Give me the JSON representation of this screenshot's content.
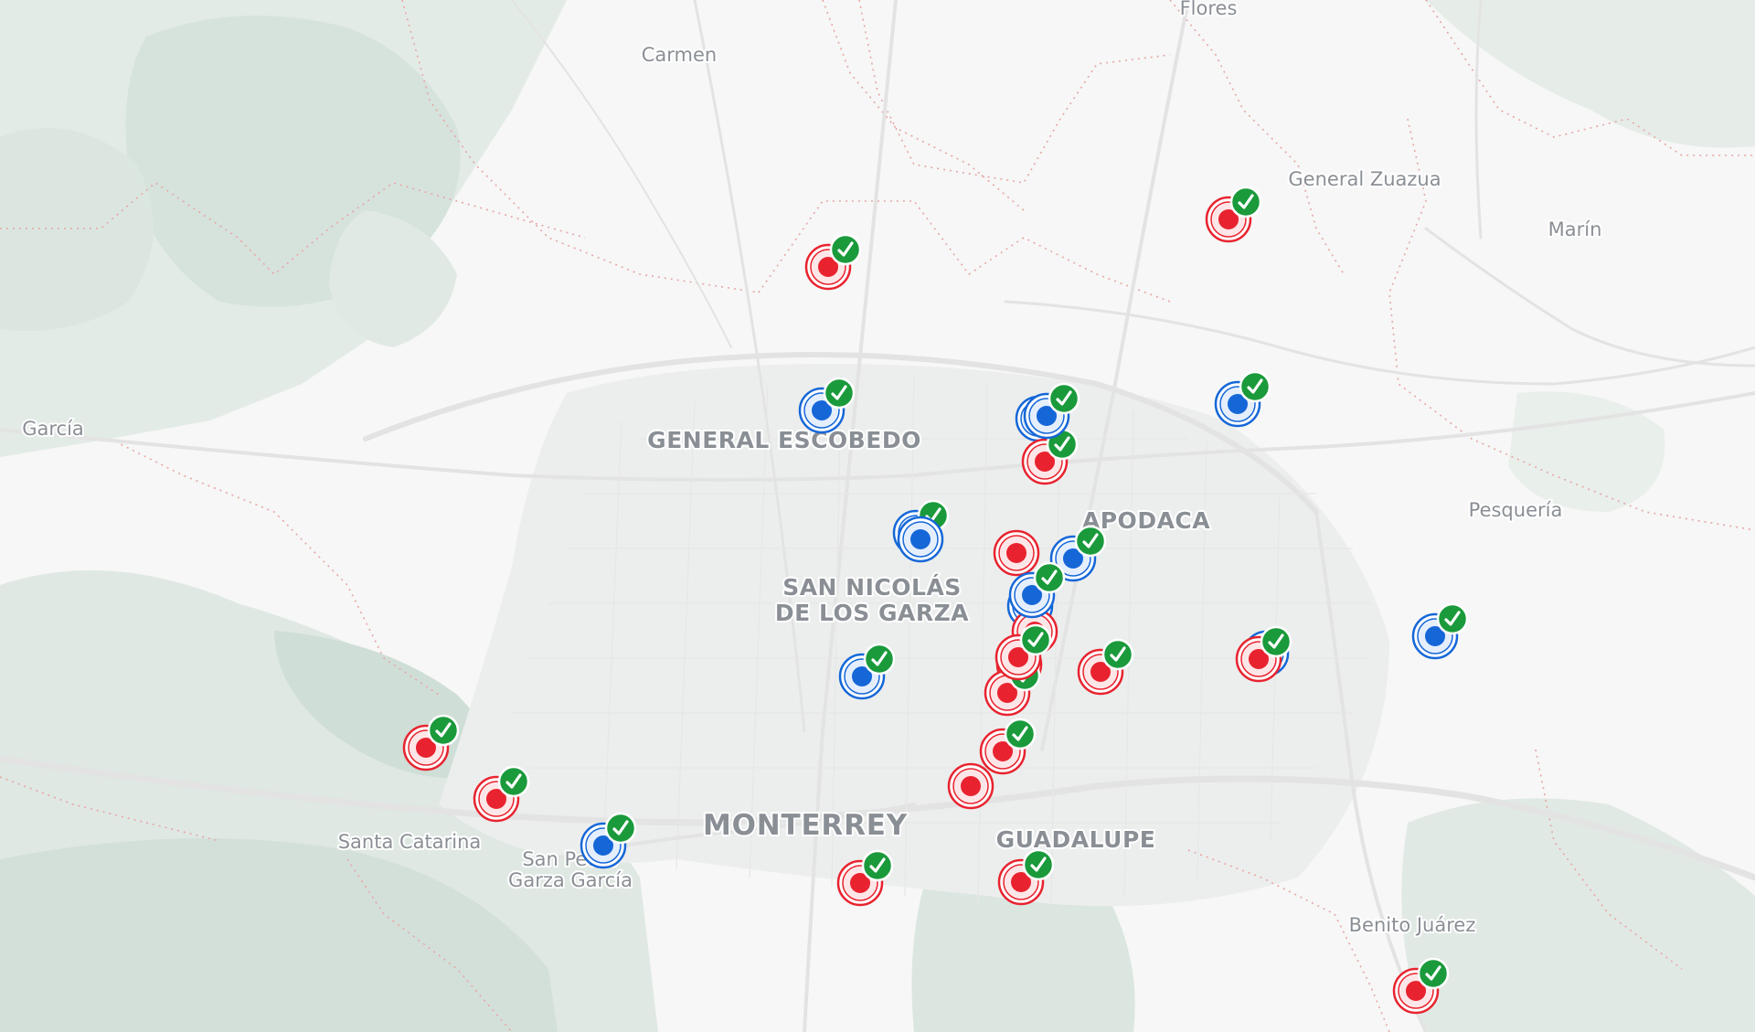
{
  "map": {
    "labels": {
      "carmen": "Carmen",
      "flores": "Flores",
      "general_zuazua": "General Zuazua",
      "marin": "Marín",
      "garcia": "García",
      "general_escobedo": "GENERAL ESCOBEDO",
      "apodaca": "APODACA",
      "pesqueria": "Pesquería",
      "san_nicolas_1": "SAN NICOLÁS",
      "san_nicolas_2": "DE LOS GARZA",
      "monterrey": "MONTERREY",
      "guadalupe": "GUADALUPE",
      "santa_catarina": "Santa Catarina",
      "san_pedro_1": "San Pedro",
      "san_pedro_2": "Garza García",
      "benito_juarez": "Benito Juárez"
    },
    "marker_types": {
      "red": "#e8232f",
      "blue": "#1567d8",
      "check": "#1a9a3b"
    },
    "markers": [
      {
        "type": "red",
        "verified": true
      },
      {
        "type": "red",
        "verified": true
      },
      {
        "type": "red",
        "verified": true
      },
      {
        "type": "blue",
        "verified": true
      },
      {
        "type": "blue",
        "verified": true
      },
      {
        "type": "blue",
        "verified": false
      },
      {
        "type": "red",
        "verified": true
      },
      {
        "type": "blue",
        "verified": true
      },
      {
        "type": "blue",
        "verified": false
      },
      {
        "type": "blue",
        "verified": true
      },
      {
        "type": "red",
        "verified": false
      },
      {
        "type": "blue",
        "verified": false
      },
      {
        "type": "blue",
        "verified": true
      },
      {
        "type": "blue",
        "verified": true
      },
      {
        "type": "blue",
        "verified": false
      },
      {
        "type": "red",
        "verified": true
      },
      {
        "type": "red",
        "verified": true
      },
      {
        "type": "red",
        "verified": false
      },
      {
        "type": "red",
        "verified": true
      },
      {
        "type": "red",
        "verified": true
      },
      {
        "type": "red",
        "verified": false
      },
      {
        "type": "blue",
        "verified": true
      },
      {
        "type": "red",
        "verified": false
      },
      {
        "type": "blue",
        "verified": true
      },
      {
        "type": "red",
        "verified": true
      },
      {
        "type": "red",
        "verified": true
      },
      {
        "type": "blue",
        "verified": true
      },
      {
        "type": "red",
        "verified": true
      },
      {
        "type": "red",
        "verified": true
      },
      {
        "type": "red",
        "verified": true
      }
    ]
  }
}
